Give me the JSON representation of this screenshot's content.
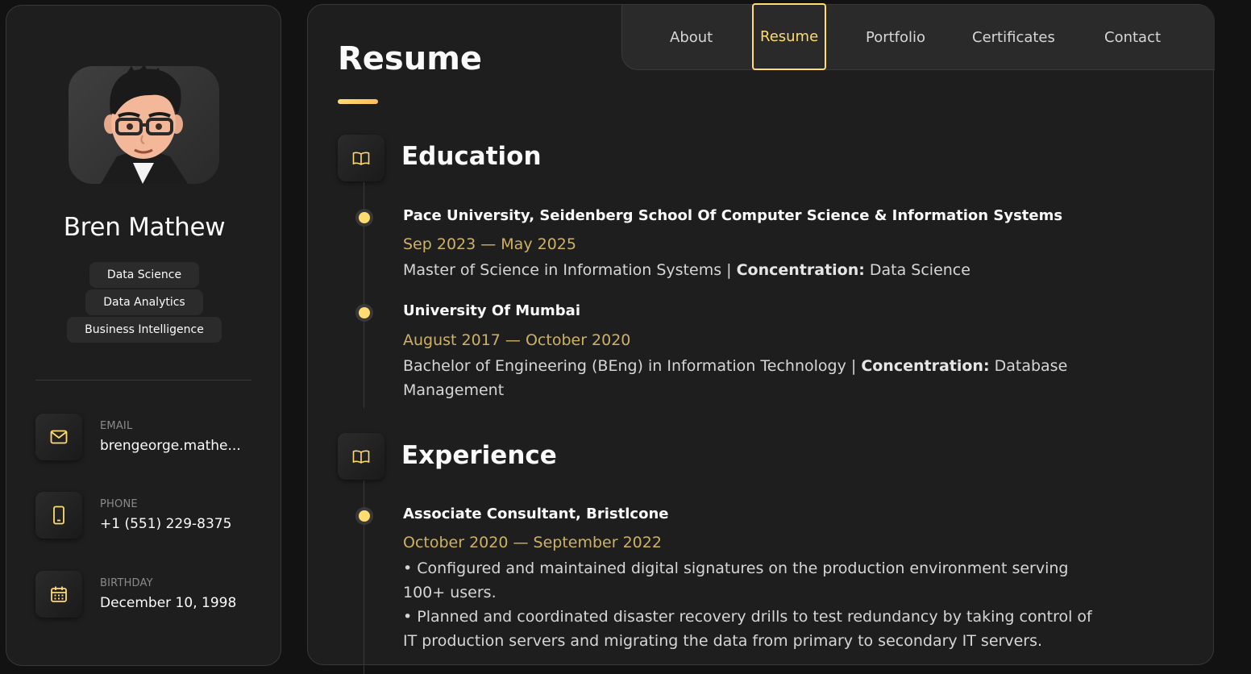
{
  "profile": {
    "name": "Bren Mathew",
    "tags": [
      "Data Science",
      "Data Analytics",
      "Business Intelligence"
    ]
  },
  "contacts": [
    {
      "label": "EMAIL",
      "value": "brengeorge.mathe...",
      "icon": "mail-icon"
    },
    {
      "label": "PHONE",
      "value": "+1 (551) 229-8375",
      "icon": "phone-icon"
    },
    {
      "label": "BIRTHDAY",
      "value": "December 10, 1998",
      "icon": "calendar-icon"
    }
  ],
  "nav": {
    "items": [
      "About",
      "Resume",
      "Portfolio",
      "Certificates",
      "Contact"
    ],
    "active": "Resume"
  },
  "page": {
    "title": "Resume"
  },
  "education": {
    "title": "Education",
    "icon": "book-icon",
    "items": [
      {
        "title": "Pace University, Seidenberg School Of Computer Science & Information Systems",
        "date": "Sep 2023 — May 2025",
        "text_main": "Master of Science in Information Systems | ",
        "text_bold": "Concentration:",
        "text_tail": " Data Science"
      },
      {
        "title": "University Of Mumbai",
        "date": "August 2017 — October 2020",
        "text_main": "Bachelor of Engineering (BEng) in Information Technology | ",
        "text_bold": "Concentration:",
        "text_tail": " Database Management"
      }
    ]
  },
  "experience": {
    "title": "Experience",
    "icon": "book-icon",
    "items": [
      {
        "title": "Associate Consultant, Bristlcone",
        "date": "October 2020 — September 2022",
        "bullets": [
          "• Configured and maintained digital signatures on the production environment serving 100+ users.",
          "• Planned and coordinated disaster recovery drills to test redundancy by taking control of IT production servers and migrating the data from primary to secondary IT servers."
        ]
      }
    ]
  },
  "colors": {
    "accent": "#ffdb70",
    "date": "#ceb162",
    "panel": "#1e1e1f",
    "background": "#121212"
  }
}
